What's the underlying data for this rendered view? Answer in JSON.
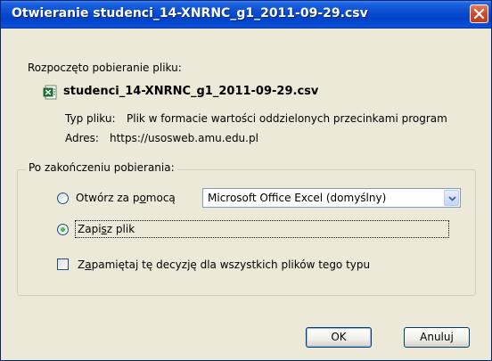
{
  "window": {
    "title": "Otwieranie studenci_14-XNRNC_g1_2011-09-29.csv"
  },
  "dialog": {
    "intro": "Rozpoczęto pobieranie pliku:",
    "file_name": "studenci_14-XNRNC_g1_2011-09-29.csv",
    "file_icon": "csv-file-icon",
    "type_label": "Typ pliku:",
    "type_value": "Plik w formacie wartości oddzielonych przecinkami program",
    "address_label": "Adres:",
    "address_value": "https://usosweb.amu.edu.pl"
  },
  "after_download": {
    "legend": "Po zakończeniu pobierania:",
    "open_with": {
      "label_pre": "Otwórz za p",
      "label_key": "o",
      "label_post": "mocą",
      "selected": false
    },
    "app_select": {
      "value": "Microsoft Office Excel (domyślny)"
    },
    "save_file": {
      "label_pre": "Zapi",
      "label_key": "s",
      "label_post": "z plik",
      "selected": true
    },
    "remember": {
      "label_pre": "Z",
      "label_key": "a",
      "label_post": "pamiętaj tę decyzję dla wszystkich plików tego typu",
      "checked": false
    }
  },
  "buttons": {
    "ok": "OK",
    "cancel": "Anuluj"
  },
  "colors": {
    "titlebar": "#0a4bd0",
    "dialog_bg": "#ece9d8",
    "close_button": "#d04a2a",
    "radio_selected": "#21a121"
  }
}
